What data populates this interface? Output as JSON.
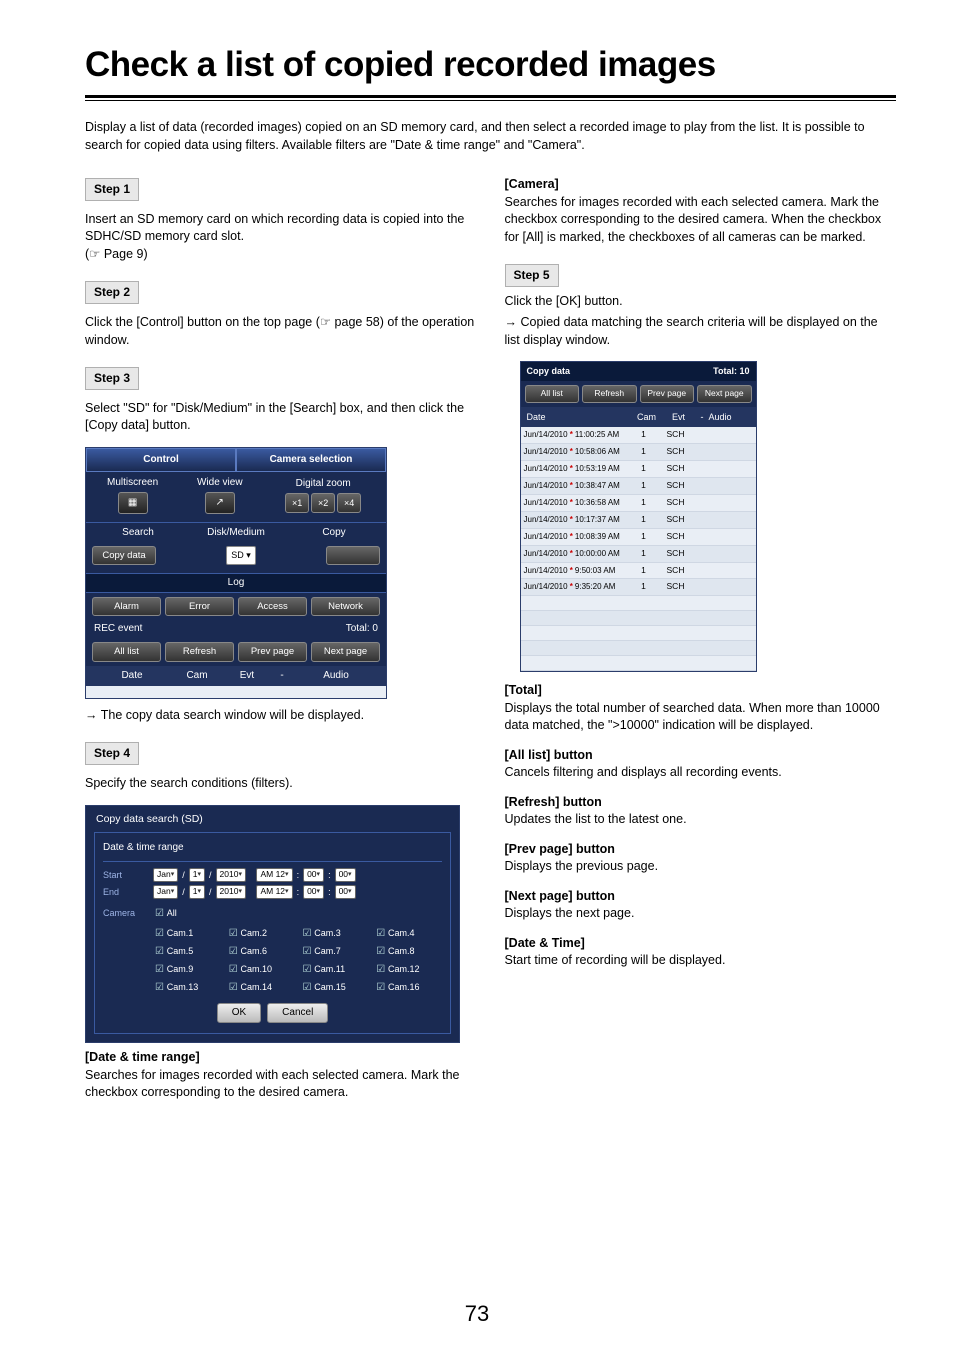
{
  "page_number": "73",
  "title": "Check a list of copied recorded images",
  "intro": "Display a list of data (recorded images) copied on an SD memory card, and then select a recorded image to play from the list. It is possible to search for copied data using filters. Available filters are \"Date & time range\" and \"Camera\".",
  "step1_label": "Step 1",
  "step1_text": "Insert an SD memory card on which recording data is copied into the SDHC/SD memory card slot.",
  "step1_ref": "(☞ Page 9)",
  "step2_label": "Step 2",
  "step2_text": "Click the [Control] button on the top page (☞ page 58) of the operation window.",
  "step3_label": "Step 3",
  "step3_text": "Select \"SD\" for \"Disk/Medium\" in the [Search] box, and then click the [Copy data] button.",
  "control_panel": {
    "header_left": "Control",
    "header_right": "Camera selection",
    "multiscreen": "Multiscreen",
    "wideview": "Wide view",
    "digital_zoom": "Digital zoom",
    "zoom": [
      "×1",
      "×2",
      "×4"
    ],
    "search": "Search",
    "disk_medium": "Disk/Medium",
    "copy": "Copy",
    "copy_data": "Copy data",
    "disk_value": "SD",
    "log": "Log",
    "log_btns": [
      "Alarm",
      "Error",
      "Access",
      "Network"
    ],
    "rec_event": "REC event",
    "total": "Total: 0",
    "rec_btns": [
      "All list",
      "Refresh",
      "Prev page",
      "Next page"
    ],
    "cols": [
      "Date",
      "Cam",
      "Evt",
      "-",
      "Audio"
    ]
  },
  "step3_result": "The copy data search window will be displayed.",
  "step4_label": "Step 4",
  "step4_text": "Specify the search conditions (filters).",
  "cds": {
    "title": "Copy data search (SD)",
    "dtr": "Date & time range",
    "start": "Start",
    "end": "End",
    "month": "Jan",
    "day": "1",
    "year": "2010",
    "ampm": "AM 12",
    "min": "00",
    "sec": "00",
    "camera": "Camera",
    "all": "All",
    "cams": [
      "Cam.1",
      "Cam.2",
      "Cam.3",
      "Cam.4",
      "Cam.5",
      "Cam.6",
      "Cam.7",
      "Cam.8",
      "Cam.9",
      "Cam.10",
      "Cam.11",
      "Cam.12",
      "Cam.13",
      "Cam.14",
      "Cam.15",
      "Cam.16"
    ],
    "ok": "OK",
    "cancel": "Cancel"
  },
  "dtr_label": "[Date & time range]",
  "dtr_text": "Searches for images recorded with each selected camera. Mark the checkbox corresponding to the desired camera.",
  "camera_label": "[Camera]",
  "camera_text": "Searches for images recorded with each selected camera. Mark the checkbox corresponding to the desired camera. When the checkbox for [All] is marked, the checkboxes of all cameras can be marked.",
  "step5_label": "Step 5",
  "step5_text": "Click the [OK] button.",
  "step5_result": "Copied data matching the search criteria will be displayed on the list display window.",
  "cdl": {
    "title": "Copy data",
    "total": "Total: 10",
    "btns": [
      "All list",
      "Refresh",
      "Prev page",
      "Next page"
    ],
    "cols": [
      "Date",
      "Cam",
      "Evt",
      "-",
      "Audio"
    ],
    "rows": [
      {
        "date": "Jun/14/2010",
        "time": "11:00:25 AM",
        "cam": "1",
        "evt": "SCH"
      },
      {
        "date": "Jun/14/2010",
        "time": "10:58:06 AM",
        "cam": "1",
        "evt": "SCH"
      },
      {
        "date": "Jun/14/2010",
        "time": "10:53:19 AM",
        "cam": "1",
        "evt": "SCH"
      },
      {
        "date": "Jun/14/2010",
        "time": "10:38:47 AM",
        "cam": "1",
        "evt": "SCH"
      },
      {
        "date": "Jun/14/2010",
        "time": "10:36:58 AM",
        "cam": "1",
        "evt": "SCH"
      },
      {
        "date": "Jun/14/2010",
        "time": "10:17:37 AM",
        "cam": "1",
        "evt": "SCH"
      },
      {
        "date": "Jun/14/2010",
        "time": "10:08:39 AM",
        "cam": "1",
        "evt": "SCH"
      },
      {
        "date": "Jun/14/2010",
        "time": "10:00:00 AM",
        "cam": "1",
        "evt": "SCH"
      },
      {
        "date": "Jun/14/2010",
        "time": "9:50:03 AM",
        "cam": "1",
        "evt": "SCH"
      },
      {
        "date": "Jun/14/2010",
        "time": "9:35:20 AM",
        "cam": "1",
        "evt": "SCH"
      }
    ]
  },
  "total_label": "[Total]",
  "total_text": "Displays the total number of searched data. When more than 10000 data matched, the \">10000\" indication will be displayed.",
  "alllist_label": "[All list] button",
  "alllist_text": "Cancels filtering and displays all recording events.",
  "refresh_label": "[Refresh] button",
  "refresh_text": "Updates the list to the latest one.",
  "prev_label": "[Prev page] button",
  "prev_text": "Displays the previous page.",
  "next_label": "[Next page] button",
  "next_text": "Displays the next page.",
  "dt_label": "[Date & Time]",
  "dt_text": "Start time of recording will be displayed."
}
